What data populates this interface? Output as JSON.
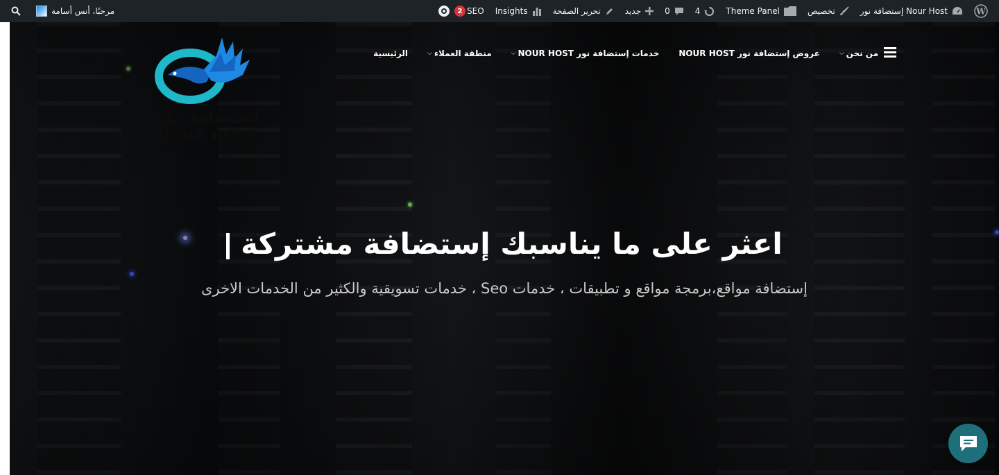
{
  "adminbar": {
    "greeting": "مرحبًا، أنس أسامة",
    "seo_label": "SEO",
    "seo_count": "2",
    "insights_label": "Insights",
    "edit_page_label": "تحرير الصفحة",
    "new_label": "جديد",
    "comments_count": "0",
    "updates_count": "4",
    "theme_panel_label": "Theme Panel",
    "customize_label": "تخصيص",
    "site_name": "إستضافة نور Nour Host"
  },
  "logo": {
    "arabic_text": "إستضافة نور",
    "english_text": "NOUR HOST"
  },
  "nav": {
    "items": [
      {
        "label": "من نحن",
        "has_dropdown": true
      },
      {
        "label": "عروض إستضافة نور NOUR HOST",
        "has_dropdown": false
      },
      {
        "label": "خدمات إستضافة نور NOUR HOST",
        "has_dropdown": true
      },
      {
        "label": "منطقة العملاء",
        "has_dropdown": true
      },
      {
        "label": "الرئيسية",
        "has_dropdown": false
      }
    ]
  },
  "hero": {
    "title": "اعثر على ما يناسبك إستضافة مشتركة",
    "subtitle": "إستضافة مواقع،برمجة مواقع و تطبيقات ، خدمات Seo ، خدمات تسويقية والكثير من الخدمات الاخرى"
  },
  "colors": {
    "adminbar_bg": "#1d2327",
    "logo_teal": "#1fb8c8",
    "logo_blue": "#1565c0",
    "chat_bg": "#1e6f7a",
    "seo_badge": "#d63638"
  }
}
